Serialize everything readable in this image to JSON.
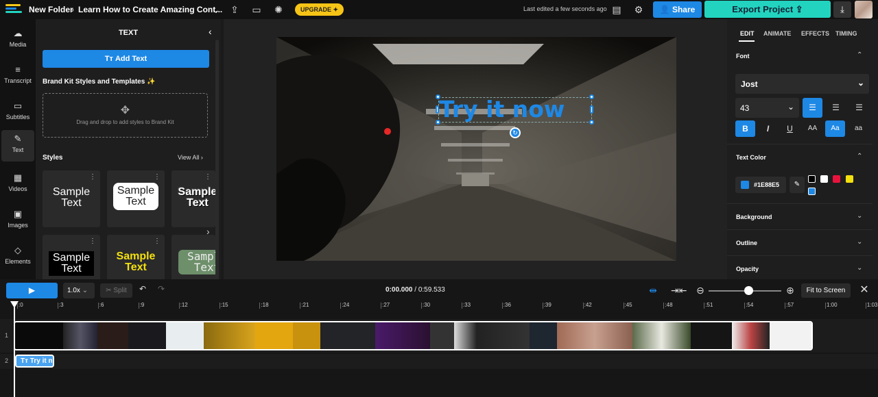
{
  "topbar": {
    "breadcrumb_folder": "New Folder",
    "breadcrumb_sep": "›",
    "project_name": "Learn How to Create Amazing Cont...",
    "upgrade_label": "UPGRADE",
    "last_edited": "Last edited a few seconds ago",
    "share_label": "Share",
    "export_label": "Export Project"
  },
  "leftnav": {
    "items": [
      {
        "label": "Media",
        "icon": "cloud-upload-icon"
      },
      {
        "label": "Transcript",
        "icon": "transcript-icon"
      },
      {
        "label": "Subtitles",
        "icon": "subtitles-icon"
      },
      {
        "label": "Text",
        "icon": "text-icon"
      },
      {
        "label": "Videos",
        "icon": "film-icon"
      },
      {
        "label": "Images",
        "icon": "image-icon"
      },
      {
        "label": "Elements",
        "icon": "shapes-icon"
      }
    ]
  },
  "textpanel": {
    "title": "TEXT",
    "add_text": "Add Text",
    "brandkit_title": "Brand Kit Styles and Templates",
    "dropzone_text": "Drag and drop to add styles to Brand Kit",
    "styles_title": "Styles",
    "view_all": "View All",
    "style_cards": [
      {
        "line1": "Sample",
        "line2": "Text"
      },
      {
        "line1": "Sample",
        "line2": "Text"
      },
      {
        "line1": "Sample",
        "line2": "Text"
      },
      {
        "line1": "Sample",
        "line2": "Text"
      },
      {
        "line1": "Sample",
        "line2": "Text"
      },
      {
        "line1": "Sample",
        "line2": "Text"
      }
    ]
  },
  "preview": {
    "overlay_text": "Try it now"
  },
  "rightpanel": {
    "tabs": [
      "EDIT",
      "ANIMATE",
      "EFFECTS",
      "TIMING"
    ],
    "font_section": "Font",
    "font_name": "Jost",
    "font_size": "43",
    "text_color_section": "Text Color",
    "text_color_hex": "#1E88E5",
    "presets": [
      "#000000",
      "#ffffff",
      "#e8133d",
      "#f3e00f",
      "#1e88e5"
    ],
    "background_section": "Background",
    "outline_section": "Outline",
    "opacity_section": "Opacity",
    "format_buttons": {
      "bold": "B",
      "italic": "I",
      "underline": "U",
      "uppercase": "AA",
      "titlecase": "Aa",
      "lowercase": "aa"
    }
  },
  "timeline": {
    "speed": "1.0x",
    "split_label": "Split",
    "current_time": "0:00.000",
    "total_time": "0:59.533",
    "fit_label": "Fit to Screen",
    "ticks": [
      ":0",
      ":3",
      ":6",
      ":9",
      ":12",
      ":15",
      ":18",
      ":21",
      ":24",
      ":27",
      ":30",
      ":33",
      ":36",
      ":39",
      ":42",
      ":45",
      ":48",
      ":51",
      ":54",
      ":57",
      "1:00",
      "1:03"
    ],
    "track1_label": "1",
    "track2_label": "2",
    "text_clip": "Try it now"
  }
}
